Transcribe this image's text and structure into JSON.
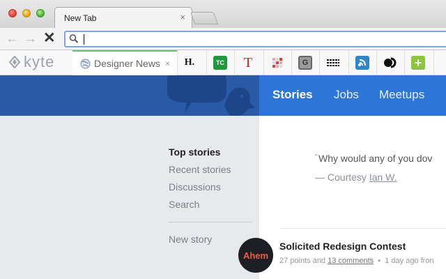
{
  "browser": {
    "tab_title": "New Tab",
    "tab_close": "×",
    "nav": {
      "back": "←",
      "forward": "→",
      "stop": "✕"
    },
    "address_value": "",
    "address_placeholder": ""
  },
  "bookmarks": {
    "kyte_label": "kyte",
    "designer_news": {
      "label": "Designer News",
      "close": "×"
    },
    "icons": [
      {
        "name": "hacker-news-icon",
        "text": "H.",
        "fg": "#111",
        "bg": "transparent"
      },
      {
        "name": "techcrunch-icon",
        "text": "TC",
        "fg": "#fff",
        "bg": "#1e9a3c"
      },
      {
        "name": "t-magazine-icon",
        "text": "T",
        "fg": "#d2232a",
        "bg": "transparent"
      },
      {
        "name": "grid-app-icon",
        "text": "",
        "fg": "#c44",
        "bg": "transparent"
      },
      {
        "name": "gizmodo-icon",
        "text": "G",
        "fg": "#333",
        "bg": "#9a9a9a"
      },
      {
        "name": "dribbble-like-icon",
        "text": "",
        "fg": "#000",
        "bg": "transparent"
      },
      {
        "name": "feed-reader-icon",
        "text": "",
        "fg": "#fff",
        "bg": "#2f86c9"
      },
      {
        "name": "dual-circle-icon",
        "text": "",
        "fg": "#000",
        "bg": "transparent"
      },
      {
        "name": "add-extension-icon",
        "text": "+",
        "fg": "#fff",
        "bg": "#8cc63e"
      }
    ]
  },
  "site": {
    "nav": {
      "stories": "Stories",
      "jobs": "Jobs",
      "meetups": "Meetups"
    },
    "sidebar": {
      "items": [
        "Top stories",
        "Recent stories",
        "Discussions",
        "Search"
      ],
      "new_story": "New story"
    },
    "quote": {
      "mark": "“",
      "text": "Why would any of you dov",
      "courtesy_prefix": "— Courtesy ",
      "author": "Ian W."
    },
    "story": {
      "avatar_text": "Ahem",
      "title": "Solicited Redesign Contest",
      "points": "27 points and ",
      "comments": "13 comments",
      "sep": "  •  ",
      "time": "1 day ago fron"
    }
  },
  "colors": {
    "header_dark": "#2a5aa6",
    "header_nav": "#2e75d8",
    "sidebar_bg": "#e8e9ed",
    "accent_green": "#6bbf73",
    "ahem_orange": "#f05a3d"
  }
}
